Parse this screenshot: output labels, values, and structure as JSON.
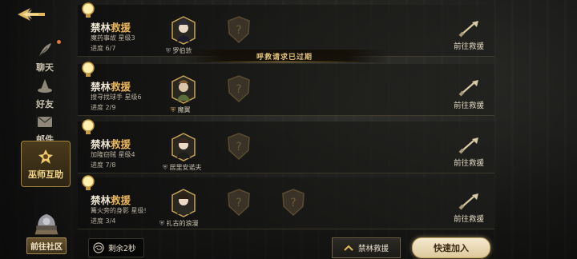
{
  "sidebar": {
    "items": [
      {
        "label": "聊天",
        "icon": "feather-icon"
      },
      {
        "label": "好友",
        "icon": "wizard-hat-icon"
      },
      {
        "label": "邮件",
        "icon": "envelope-icon"
      },
      {
        "label": "巫师互助",
        "icon": "emblem-icon",
        "active": true
      }
    ],
    "community_label": "前往社区"
  },
  "expired_notice": "呼救请求已过期",
  "rows": [
    {
      "title_a": "禁林",
      "title_b": "救援",
      "subtitle": "魔药事故 星级3",
      "progress": "进度 6/7",
      "character": "罗伯敦",
      "goto": "前往救援"
    },
    {
      "title_a": "禁林",
      "title_b": "救援",
      "subtitle": "搜寻找球手 星级6",
      "progress": "进度 2/9",
      "character": "魔翼",
      "goto": "前往救援"
    },
    {
      "title_a": "禁林",
      "title_b": "救援",
      "subtitle": "加隆窃贼 星级4",
      "progress": "进度 7/8",
      "character": "居里安诺夫",
      "goto": "前往救援"
    },
    {
      "title_a": "禁林",
      "title_b": "救援",
      "subtitle": "篝火旁的身影 星级!",
      "progress": "进度 3/4",
      "character": "扎古的浪漫",
      "goto": "前往救援"
    }
  ],
  "bottom": {
    "timer": "剩余2秒",
    "forest_button": "禁林救援",
    "join_button": "快速加入"
  },
  "colors": {
    "accent_gold": "#e8b55a",
    "banner_text": "#e2c27a"
  }
}
